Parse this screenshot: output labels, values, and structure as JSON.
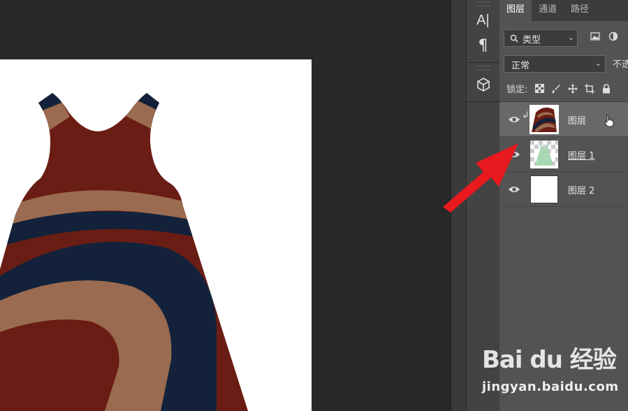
{
  "layers_panel": {
    "tabs": [
      {
        "label": "图层",
        "active": true
      },
      {
        "label": "通道",
        "active": false
      },
      {
        "label": "路径",
        "active": false
      }
    ],
    "filter": {
      "value": "类型",
      "icon": "search-icon"
    },
    "blend_mode": {
      "value": "正常"
    },
    "opacity_label": "不透",
    "lock_label": "锁定:",
    "layers": [
      {
        "name": "图层",
        "selected": true,
        "clipped": true,
        "visible": true,
        "thumb": "pattern-thumbnail"
      },
      {
        "name": "图层 1",
        "selected": false,
        "clipped": false,
        "visible": true,
        "thumb": "dress-thumbnail"
      },
      {
        "name": "图层 2",
        "selected": false,
        "clipped": false,
        "visible": true,
        "thumb": "white-thumbnail"
      }
    ]
  },
  "mini_panel": {
    "buttons": [
      "character-panel-icon",
      "paragraph-panel-icon",
      "3d-panel-icon"
    ],
    "character_glyph": "A|",
    "paragraph_glyph": "¶"
  },
  "watermark": {
    "brand": "Bai du 经验",
    "url": "jingyan.baidu.com"
  },
  "colors": {
    "dress_red": "#6a1d14",
    "dress_tan": "#9a6b50",
    "dress_navy": "#13223a",
    "arrow_red": "#e8191f",
    "panel_bg": "#535353",
    "canvas_bg": "#282828"
  }
}
